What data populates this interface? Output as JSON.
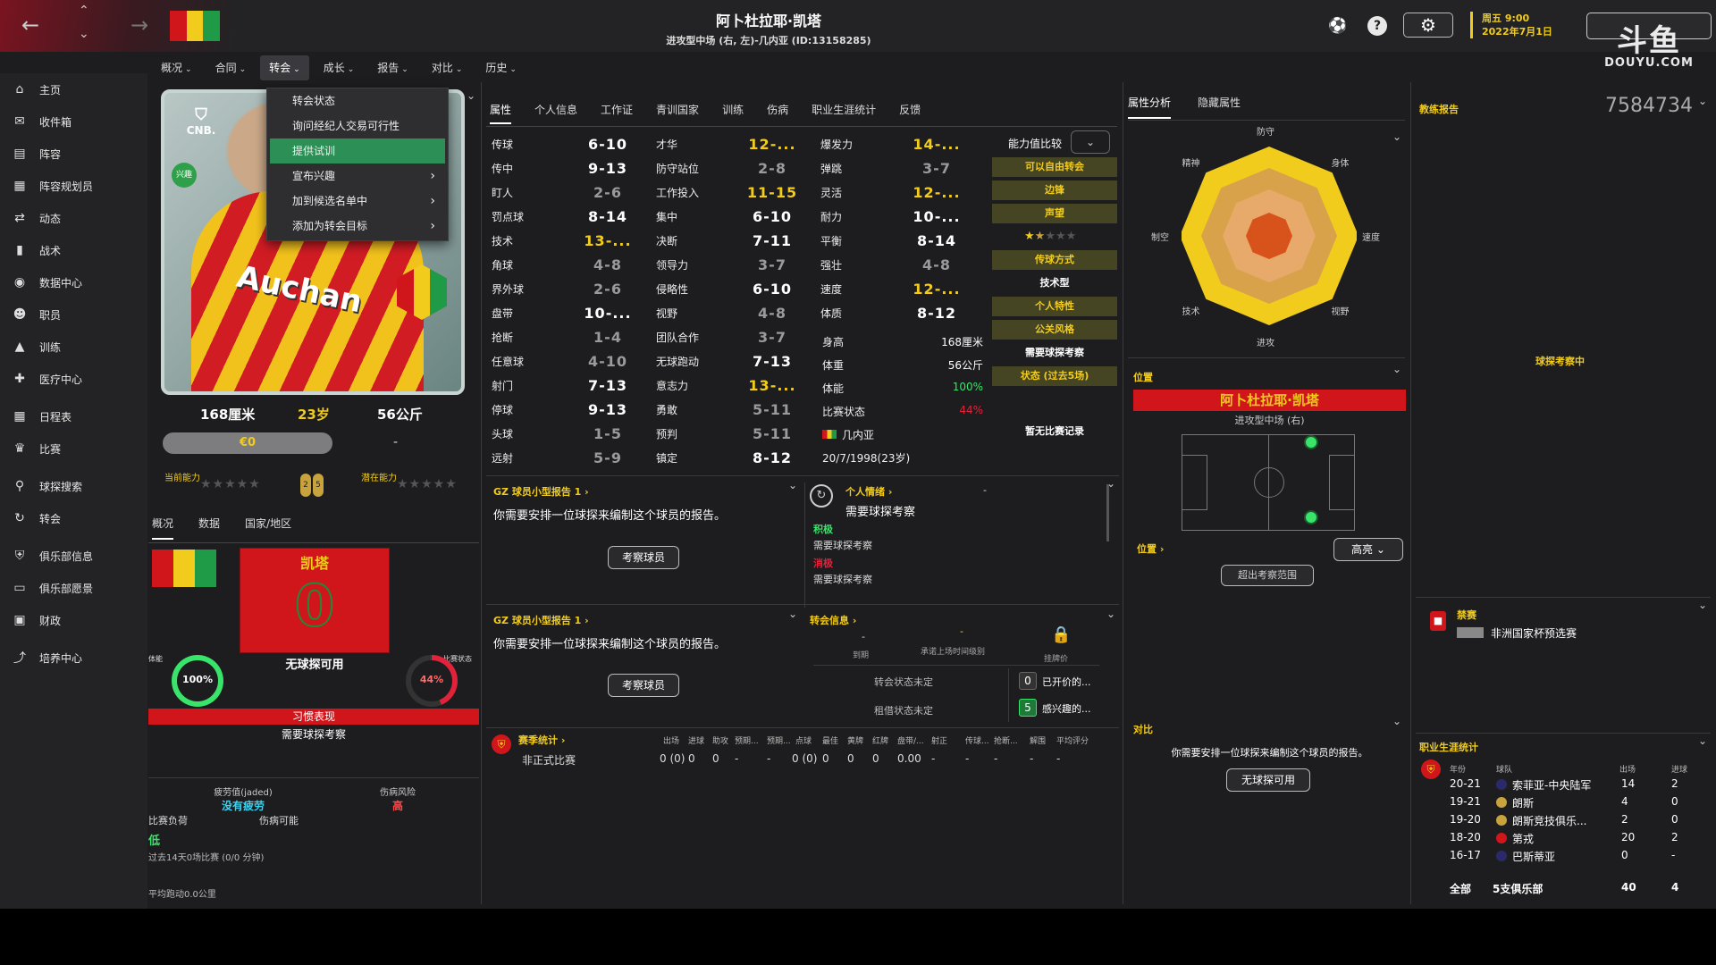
{
  "player": {
    "name": "阿卜杜拉耶·凯塔",
    "subtitle": "进攻型中场 (右, 左)-几内亚 (ID:13158285)",
    "height": "168厘米",
    "age": "23岁",
    "weight": "56公斤",
    "value": "€0",
    "value_dash": "-",
    "current_ability_label": "当前能力",
    "potential_ability_label": "潜在能力",
    "potential_nums": [
      "2",
      "5"
    ],
    "card_badge": "兴趣",
    "card_logo": "CNB.",
    "card_sponsor": "Auchan",
    "kit_name": "凯塔",
    "kit_number": "0",
    "kit_status": "无球探可用"
  },
  "topbar": {
    "date_line1": "周五 9:00",
    "date_line2": "2022年7月1日",
    "help_icon": "?",
    "watermark": "斗鱼",
    "watermark_sub": "DOUYU.COM"
  },
  "colors": {
    "accent_yellow": "#f2cc1c",
    "club_red": "#d0161b",
    "highlight_green": "#2c8f56"
  },
  "menu": [
    {
      "label": "概况"
    },
    {
      "label": "合同"
    },
    {
      "label": "转会"
    },
    {
      "label": "成长"
    },
    {
      "label": "报告"
    },
    {
      "label": "对比"
    },
    {
      "label": "历史"
    }
  ],
  "dropdown": {
    "items": [
      "转会状态",
      "询问经纪人交易可行性",
      "提供试训",
      "宣布兴趣",
      "加到候选名单中",
      "添加为转会目标"
    ]
  },
  "sidebar": {
    "items": [
      {
        "label": "主页",
        "icon": "home-icon",
        "glyph": "⌂"
      },
      {
        "label": "收件箱",
        "icon": "inbox-icon",
        "glyph": "✉"
      },
      {
        "label": "阵容",
        "icon": "squad-icon",
        "glyph": "▤"
      },
      {
        "label": "阵容规划员",
        "icon": "planner-icon",
        "glyph": "▦"
      },
      {
        "label": "动态",
        "icon": "dynamics-icon",
        "glyph": "⇄"
      },
      {
        "label": "战术",
        "icon": "tactics-icon",
        "glyph": "▮"
      },
      {
        "label": "数据中心",
        "icon": "data-hub-icon",
        "glyph": "◉"
      },
      {
        "label": "职员",
        "icon": "staff-icon",
        "glyph": "☻"
      },
      {
        "label": "训练",
        "icon": "training-icon",
        "glyph": "▲"
      },
      {
        "label": "医疗中心",
        "icon": "medical-icon",
        "glyph": "✚"
      },
      {
        "label": "日程表",
        "icon": "calendar-icon",
        "glyph": "▦"
      },
      {
        "label": "比赛",
        "icon": "trophy-icon",
        "glyph": "♛"
      },
      {
        "label": "球探搜索",
        "icon": "scout-search-icon",
        "glyph": "⚲"
      },
      {
        "label": "转会",
        "icon": "transfer-icon",
        "glyph": "↻"
      },
      {
        "label": "俱乐部信息",
        "icon": "club-info-icon",
        "glyph": "⛨"
      },
      {
        "label": "俱乐部愿景",
        "icon": "club-vision-icon",
        "glyph": "▭"
      },
      {
        "label": "财政",
        "icon": "finances-icon",
        "glyph": "▣"
      },
      {
        "label": "培养中心",
        "icon": "development-icon",
        "glyph": "⤴"
      }
    ]
  },
  "left_subtabs": [
    "概况",
    "数据",
    "国家/地区"
  ],
  "left_stats": {
    "condition_label": "体能",
    "condition_value": "100%",
    "condition_fraction": 1.0,
    "match_sharpness_label": "比赛状态",
    "match_sharpness_value": "44%",
    "match_sharpness_fraction": 0.44,
    "habit_bar": "习惯表现",
    "habit_text": "需要球探考察",
    "fatigue_label": "疲劳值(jaded)",
    "fatigue_value": "没有疲劳",
    "injury_risk_label": "伤病风险",
    "injury_risk_value": "高",
    "match_load_label": "比赛负荷",
    "match_load_value": "低",
    "injury_possible_label": "伤病可能",
    "last14_text": "过去14天0场比赛 (0/0 分钟)",
    "avg_run": "平均跑动0.0公里"
  },
  "attr_tabs": [
    "属性",
    "个人信息",
    "工作证",
    "青训国家",
    "训练",
    "伤病",
    "职业生涯统计",
    "反馈"
  ],
  "attributes": {
    "col1": [
      {
        "label": "传球",
        "value": "6-10",
        "tone": "white"
      },
      {
        "label": "传中",
        "value": "9-13",
        "tone": "white"
      },
      {
        "label": "盯人",
        "value": "2-6",
        "tone": "gray"
      },
      {
        "label": "罚点球",
        "value": "8-14",
        "tone": "white"
      },
      {
        "label": "技术",
        "value": "13-...",
        "tone": "yellow"
      },
      {
        "label": "角球",
        "value": "4-8",
        "tone": "gray"
      },
      {
        "label": "界外球",
        "value": "2-6",
        "tone": "gray"
      },
      {
        "label": "盘带",
        "value": "10-...",
        "tone": "white"
      },
      {
        "label": "抢断",
        "value": "1-4",
        "tone": "gray"
      },
      {
        "label": "任意球",
        "value": "4-10",
        "tone": "gray"
      },
      {
        "label": "射门",
        "value": "7-13",
        "tone": "white"
      },
      {
        "label": "停球",
        "value": "9-13",
        "tone": "white"
      },
      {
        "label": "头球",
        "value": "1-5",
        "tone": "gray"
      },
      {
        "label": "远射",
        "value": "5-9",
        "tone": "gray"
      }
    ],
    "col2": [
      {
        "label": "才华",
        "value": "12-...",
        "tone": "yellow"
      },
      {
        "label": "防守站位",
        "value": "2-8",
        "tone": "gray"
      },
      {
        "label": "工作投入",
        "value": "11-15",
        "tone": "yellow"
      },
      {
        "label": "集中",
        "value": "6-10",
        "tone": "white"
      },
      {
        "label": "决断",
        "value": "7-11",
        "tone": "white"
      },
      {
        "label": "领导力",
        "value": "3-7",
        "tone": "gray"
      },
      {
        "label": "侵略性",
        "value": "6-10",
        "tone": "white"
      },
      {
        "label": "视野",
        "value": "4-8",
        "tone": "gray"
      },
      {
        "label": "团队合作",
        "value": "3-7",
        "tone": "gray"
      },
      {
        "label": "无球跑动",
        "value": "7-13",
        "tone": "white"
      },
      {
        "label": "意志力",
        "value": "13-...",
        "tone": "yellow"
      },
      {
        "label": "勇敢",
        "value": "5-11",
        "tone": "gray"
      },
      {
        "label": "预判",
        "value": "5-11",
        "tone": "gray"
      },
      {
        "label": "镇定",
        "value": "8-12",
        "tone": "white"
      }
    ],
    "col3": [
      {
        "label": "爆发力",
        "value": "14-...",
        "tone": "yellow"
      },
      {
        "label": "弹跳",
        "value": "3-7",
        "tone": "gray"
      },
      {
        "label": "灵活",
        "value": "12-...",
        "tone": "yellow"
      },
      {
        "label": "耐力",
        "value": "10-...",
        "tone": "white"
      },
      {
        "label": "平衡",
        "value": "8-14",
        "tone": "white"
      },
      {
        "label": "强壮",
        "value": "4-8",
        "tone": "gray"
      },
      {
        "label": "速度",
        "value": "12-...",
        "tone": "yellow"
      },
      {
        "label": "体质",
        "value": "8-12",
        "tone": "white"
      }
    ],
    "props": [
      {
        "label": "身高",
        "value": "168厘米"
      },
      {
        "label": "体重",
        "value": "56公斤"
      },
      {
        "label": "体能",
        "value": "100%"
      },
      {
        "label": "比赛状态",
        "value": "44%"
      },
      {
        "label": "几内亚",
        "value": ""
      },
      {
        "label": "20/7/1998(23岁)",
        "value": ""
      }
    ]
  },
  "traits": {
    "compare_label": "能力值比较",
    "items": [
      {
        "text": "可以自由转会",
        "kind": "hdr"
      },
      {
        "text": "边锋",
        "kind": "hdr"
      },
      {
        "text": "声望",
        "kind": "hdr"
      },
      {
        "text": "★★☆☆☆",
        "kind": "stars",
        "rating": 1.5
      },
      {
        "text": "传球方式",
        "kind": "hdr"
      },
      {
        "text": "技术型",
        "kind": "txt"
      },
      {
        "text": "个人特性",
        "kind": "hdr"
      },
      {
        "text": "公关风格",
        "kind": "hdr"
      },
      {
        "text": "需要球探考察",
        "kind": "txt"
      },
      {
        "text": "状态 (过去5场)",
        "kind": "hdr"
      },
      {
        "text": "暂无比赛记录",
        "kind": "txt"
      }
    ]
  },
  "reports": {
    "title1": "GZ 球员小型报告 1",
    "text1": "你需要安排一位球探来编制这个球员的报告。",
    "button1": "考察球员",
    "title2": "GZ 球员小型报告 1",
    "text2": "你需要安排一位球探来编制这个球员的报告。",
    "button2": "考察球员"
  },
  "personal": {
    "title": "个人情绪",
    "dash": "-",
    "needs_scout": "需要球探考察",
    "positive": "积极",
    "positive_text": "需要球探考察",
    "negative": "消极",
    "negative_text": "需要球探考察"
  },
  "transfer_info": {
    "title": "转会信息",
    "dash1": "-",
    "dash2": "-",
    "expires_label": "到期",
    "appearance_label": "承诺上场时间级别",
    "asking_label": "挂牌价",
    "transfer_status": "转会状态未定",
    "loan_status": "租借状态未定",
    "offers_count": "0",
    "offers_label": "已开价的...",
    "interested_count": "5",
    "interested_label": "感兴趣的..."
  },
  "season_stats": {
    "title": "赛季统计",
    "headers": [
      "出场",
      "进球",
      "助攻",
      "预期...",
      "预期...",
      "点球",
      "最佳",
      "黄牌",
      "红牌",
      "盘带/...",
      "射正",
      "传球...",
      "抢断...",
      "解围",
      "平均评分"
    ],
    "row_label": "非正式比赛",
    "row_values": [
      "0 (0)",
      "0",
      "0",
      "-",
      "-",
      "0 (0)",
      "0",
      "0",
      "0",
      "0.00",
      "-",
      "-",
      "-",
      "-",
      "-"
    ]
  },
  "analysis": {
    "tabs": [
      "属性分析",
      "隐藏属性"
    ],
    "radar_labels": [
      "防守",
      "身体",
      "速度",
      "视野",
      "进攻",
      "技术",
      "制空",
      "精神"
    ],
    "position_title": "位置",
    "position_name": "阿卜杜拉耶·凯塔",
    "position_role": "进攻型中场 (右)",
    "position_link": "位置",
    "highlight_select": "高亮",
    "out_of_range_button": "超出考察范围",
    "compare_title": "对比",
    "compare_text": "你需要安排一位球探来编制这个球员的报告。",
    "no_scout_button": "无球探可用"
  },
  "coach_report": {
    "title": "教练报告",
    "number": "7584734",
    "scouting": "球探考察中",
    "ban_title": "禁赛",
    "ban_text": "非洲国家杯预选赛"
  },
  "career": {
    "title": "职业生涯统计",
    "headers": [
      "年份",
      "球队",
      "出场",
      "进球"
    ],
    "rows": [
      {
        "year": "20-21",
        "team": "索菲亚-中央陆军",
        "apps": "14",
        "goals": "2"
      },
      {
        "year": "19-21",
        "team": "朗斯",
        "apps": "4",
        "goals": "0"
      },
      {
        "year": "19-20",
        "team": "朗斯竞技俱乐...",
        "apps": "2",
        "goals": "0"
      },
      {
        "year": "18-20",
        "team": "第戎",
        "apps": "20",
        "goals": "2"
      },
      {
        "year": "16-17",
        "team": "巴斯蒂亚",
        "apps": "0",
        "goals": "-"
      }
    ],
    "total_label": "全部",
    "total_clubs": "5支俱乐部",
    "total_apps": "40",
    "total_goals": "4"
  }
}
